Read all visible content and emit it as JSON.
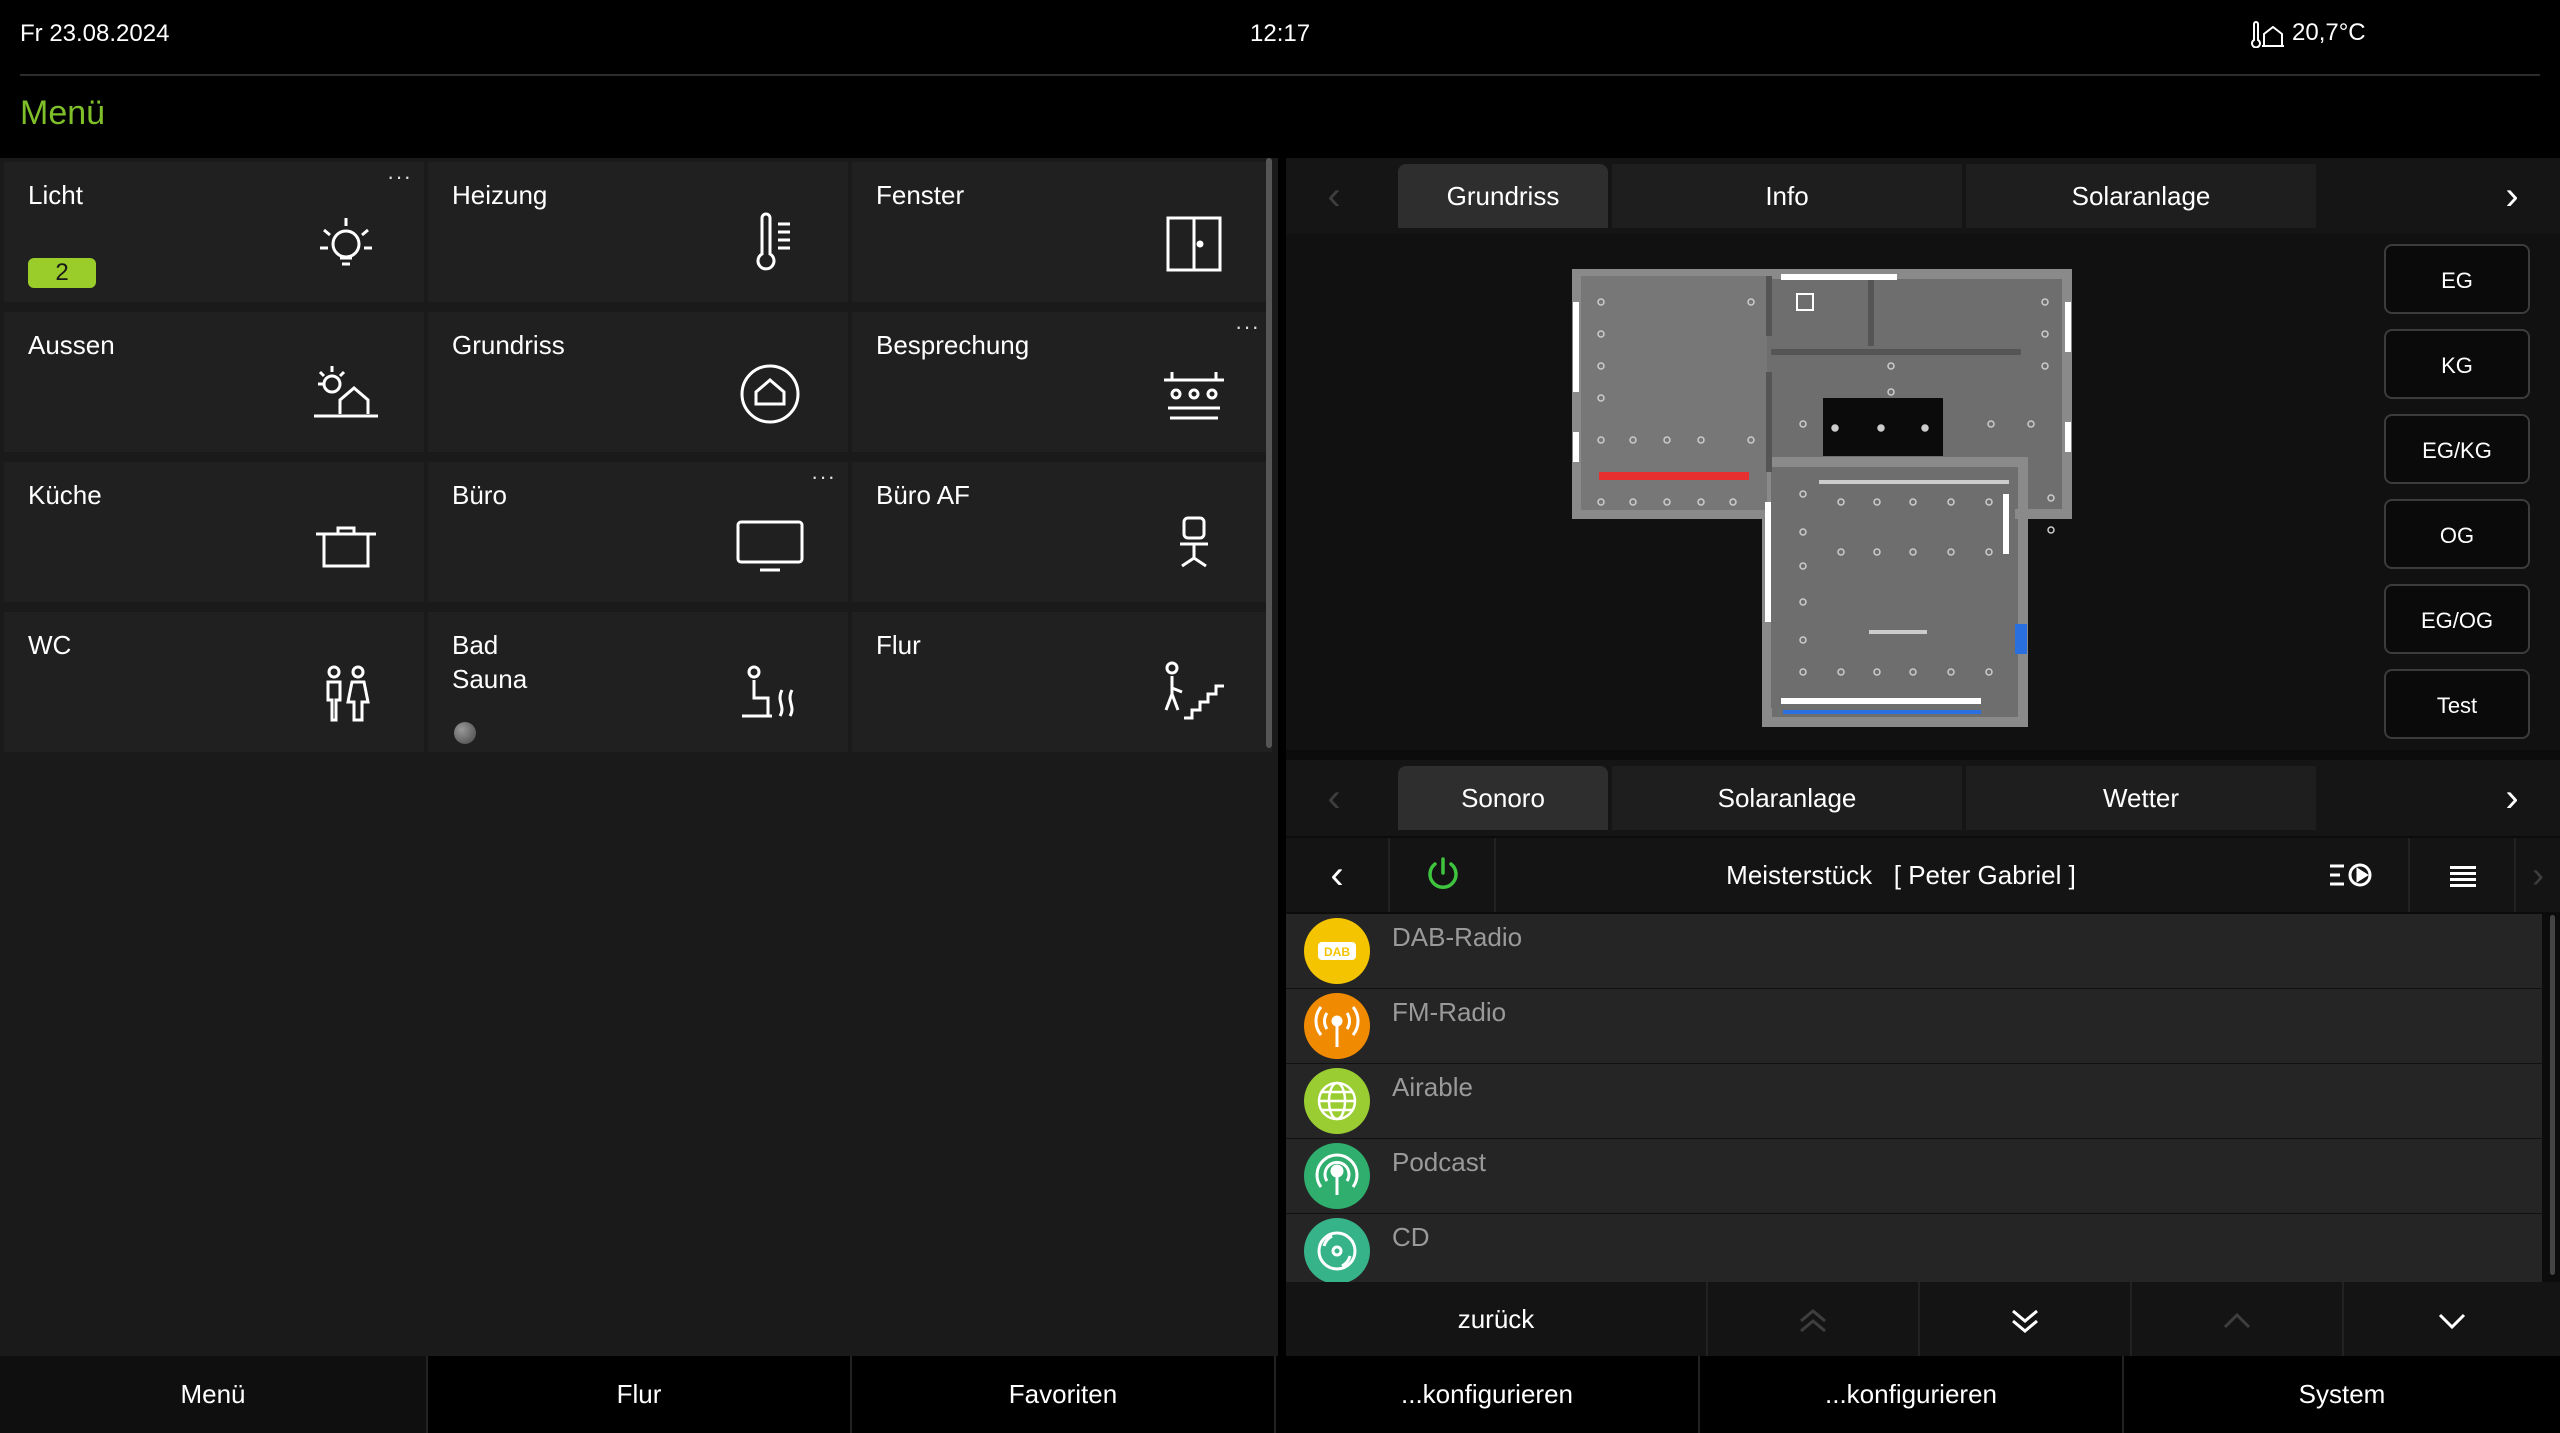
{
  "status": {
    "date": "Fr  23.08.2024",
    "time": "12:17",
    "temperature": "20,7°C",
    "weather_icon": "house-thermometer-icon"
  },
  "title": "Menü",
  "tiles": [
    {
      "label": "Licht",
      "icon": "lightbulb-icon",
      "badge": "2",
      "more": "···"
    },
    {
      "label": "Heizung",
      "icon": "thermometer-icon"
    },
    {
      "label": "Fenster",
      "icon": "window-icon"
    },
    {
      "label": "Aussen",
      "icon": "sun-house-icon"
    },
    {
      "label": "Grundriss",
      "icon": "house-circle-icon"
    },
    {
      "label": "Besprechung",
      "icon": "meeting-room-icon",
      "more": "···"
    },
    {
      "label": "Küche",
      "icon": "cooking-pot-icon"
    },
    {
      "label": "Büro",
      "icon": "monitor-icon",
      "more": "···"
    },
    {
      "label": "Büro AF",
      "icon": "office-chair-icon"
    },
    {
      "label": "WC",
      "icon": "toilet-people-icon"
    },
    {
      "label": "Bad\nSauna",
      "icon": "sauna-icon"
    },
    {
      "label": "Flur",
      "icon": "stairs-walker-icon"
    }
  ],
  "top_tabs": [
    "Grundriss",
    "Info",
    "Solaranlage"
  ],
  "floor_buttons": [
    "EG",
    "KG",
    "EG/KG",
    "OG",
    "EG/OG",
    "Test"
  ],
  "bottom_tabs": [
    "Sonoro",
    "Solaranlage",
    "Wetter"
  ],
  "player": {
    "now_playing": "Meisterstück   [ Peter Gabriel ]"
  },
  "sources": [
    {
      "name": "DAB-Radio",
      "color": "#f5c400",
      "icon": "dab-icon"
    },
    {
      "name": "FM-Radio",
      "color": "#f08a00",
      "icon": "radio-antenna-icon"
    },
    {
      "name": "Airable",
      "color": "#9acd32",
      "icon": "globe-icon"
    },
    {
      "name": "Podcast",
      "color": "#2fae6e",
      "icon": "podcast-icon"
    },
    {
      "name": "CD",
      "color": "#37b38a",
      "icon": "cd-icon"
    }
  ],
  "nav": {
    "back": "zurück"
  },
  "bottom_nav": [
    "Menü",
    "Flur",
    "Favoriten",
    "...konfigurieren",
    "...konfigurieren",
    "System"
  ]
}
